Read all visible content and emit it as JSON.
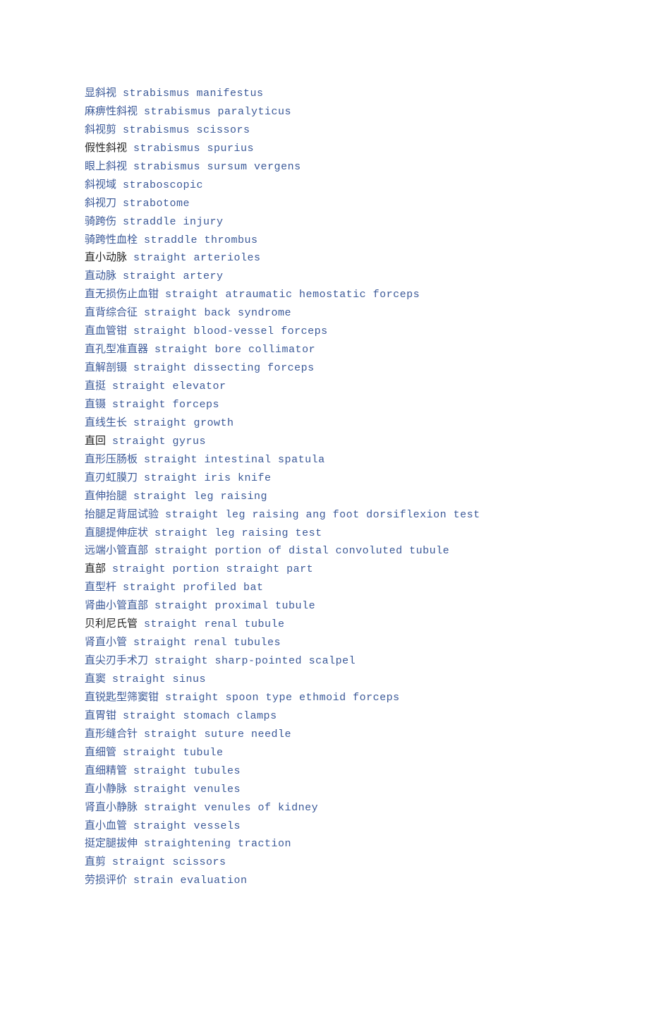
{
  "entries": [
    {
      "zh": "显斜视",
      "en": "strabismus manifestus",
      "zhBlack": false
    },
    {
      "zh": "麻痹性斜视",
      "en": "strabismus paralyticus",
      "zhBlack": false
    },
    {
      "zh": "斜视剪",
      "en": "strabismus scissors",
      "zhBlack": false
    },
    {
      "zh": "假性斜视",
      "en": "strabismus spurius",
      "zhBlack": true
    },
    {
      "zh": "眼上斜视",
      "en": "strabismus sursum vergens",
      "zhBlack": false
    },
    {
      "zh": "斜视域",
      "en": "straboscopic",
      "zhBlack": false
    },
    {
      "zh": "斜视刀",
      "en": "strabotome",
      "zhBlack": false
    },
    {
      "zh": "骑跨伤",
      "en": "straddle injury",
      "zhBlack": false
    },
    {
      "zh": "骑跨性血栓",
      "en": "straddle thrombus",
      "zhBlack": false
    },
    {
      "zh": "直小动脉",
      "en": "straight arterioles",
      "zhBlack": true
    },
    {
      "zh": "直动脉",
      "en": "straight artery",
      "zhBlack": false
    },
    {
      "zh": "直无损伤止血钳",
      "en": "straight atraumatic hemostatic forceps",
      "zhBlack": false
    },
    {
      "zh": "直背综合征",
      "en": "straight back syndrome",
      "zhBlack": false
    },
    {
      "zh": "直血管钳",
      "en": "straight blood-vessel forceps",
      "zhBlack": false
    },
    {
      "zh": "直孔型准直器",
      "en": "straight bore collimator",
      "zhBlack": false
    },
    {
      "zh": "直解剖镊",
      "en": "straight dissecting forceps",
      "zhBlack": false
    },
    {
      "zh": "直挺",
      "en": "straight elevator",
      "zhBlack": false
    },
    {
      "zh": "直镊",
      "en": "straight forceps",
      "zhBlack": false
    },
    {
      "zh": "直线生长",
      "en": "straight growth",
      "zhBlack": false
    },
    {
      "zh": "直回",
      "en": "straight gyrus",
      "zhBlack": true
    },
    {
      "zh": "直形压肠板",
      "en": "straight intestinal spatula",
      "zhBlack": false
    },
    {
      "zh": "直刃虹膜刀",
      "en": "straight iris knife",
      "zhBlack": false
    },
    {
      "zh": "直伸抬腿",
      "en": "straight leg raising",
      "zhBlack": false
    },
    {
      "zh": "抬腿足背屈试验",
      "en": "straight leg raising ang foot dorsiflexion test",
      "zhBlack": false
    },
    {
      "zh": "直腿提伸症状",
      "en": "straight leg raising test",
      "zhBlack": false
    },
    {
      "zh": "远端小管直部",
      "en": "straight portion of distal convoluted tubule",
      "zhBlack": false
    },
    {
      "zh": "直部",
      "en": "straight portion straight part",
      "zhBlack": true
    },
    {
      "zh": "直型杆",
      "en": "straight profiled bat",
      "zhBlack": false
    },
    {
      "zh": "肾曲小管直部",
      "en": "straight proximal tubule",
      "zhBlack": false
    },
    {
      "zh": "贝利尼氏管",
      "en": "straight renal tubule",
      "zhBlack": true
    },
    {
      "zh": "肾直小管",
      "en": "straight renal tubules",
      "zhBlack": false
    },
    {
      "zh": "直尖刃手术刀",
      "en": "straight sharp-pointed scalpel",
      "zhBlack": false
    },
    {
      "zh": "直窦",
      "en": "straight sinus",
      "zhBlack": false
    },
    {
      "zh": "直锐匙型筛窦钳",
      "en": "straight spoon type ethmoid forceps",
      "zhBlack": false
    },
    {
      "zh": "直胃钳",
      "en": "straight stomach clamps",
      "zhBlack": false
    },
    {
      "zh": "直形缝合针",
      "en": "straight suture needle",
      "zhBlack": false
    },
    {
      "zh": "直细管",
      "en": "straight tubule",
      "zhBlack": false
    },
    {
      "zh": "直细精管",
      "en": "straight tubules",
      "zhBlack": false
    },
    {
      "zh": "直小静脉",
      "en": "straight venules",
      "zhBlack": false
    },
    {
      "zh": "肾直小静脉",
      "en": "straight venules of kidney",
      "zhBlack": false
    },
    {
      "zh": "直小血管",
      "en": "straight vessels",
      "zhBlack": false
    },
    {
      "zh": "挺定腿拔伸",
      "en": "straightening traction",
      "zhBlack": false
    },
    {
      "zh": "直剪",
      "en": "straignt scissors",
      "zhBlack": false
    },
    {
      "zh": "劳损评价",
      "en": "strain evaluation",
      "zhBlack": false
    }
  ]
}
